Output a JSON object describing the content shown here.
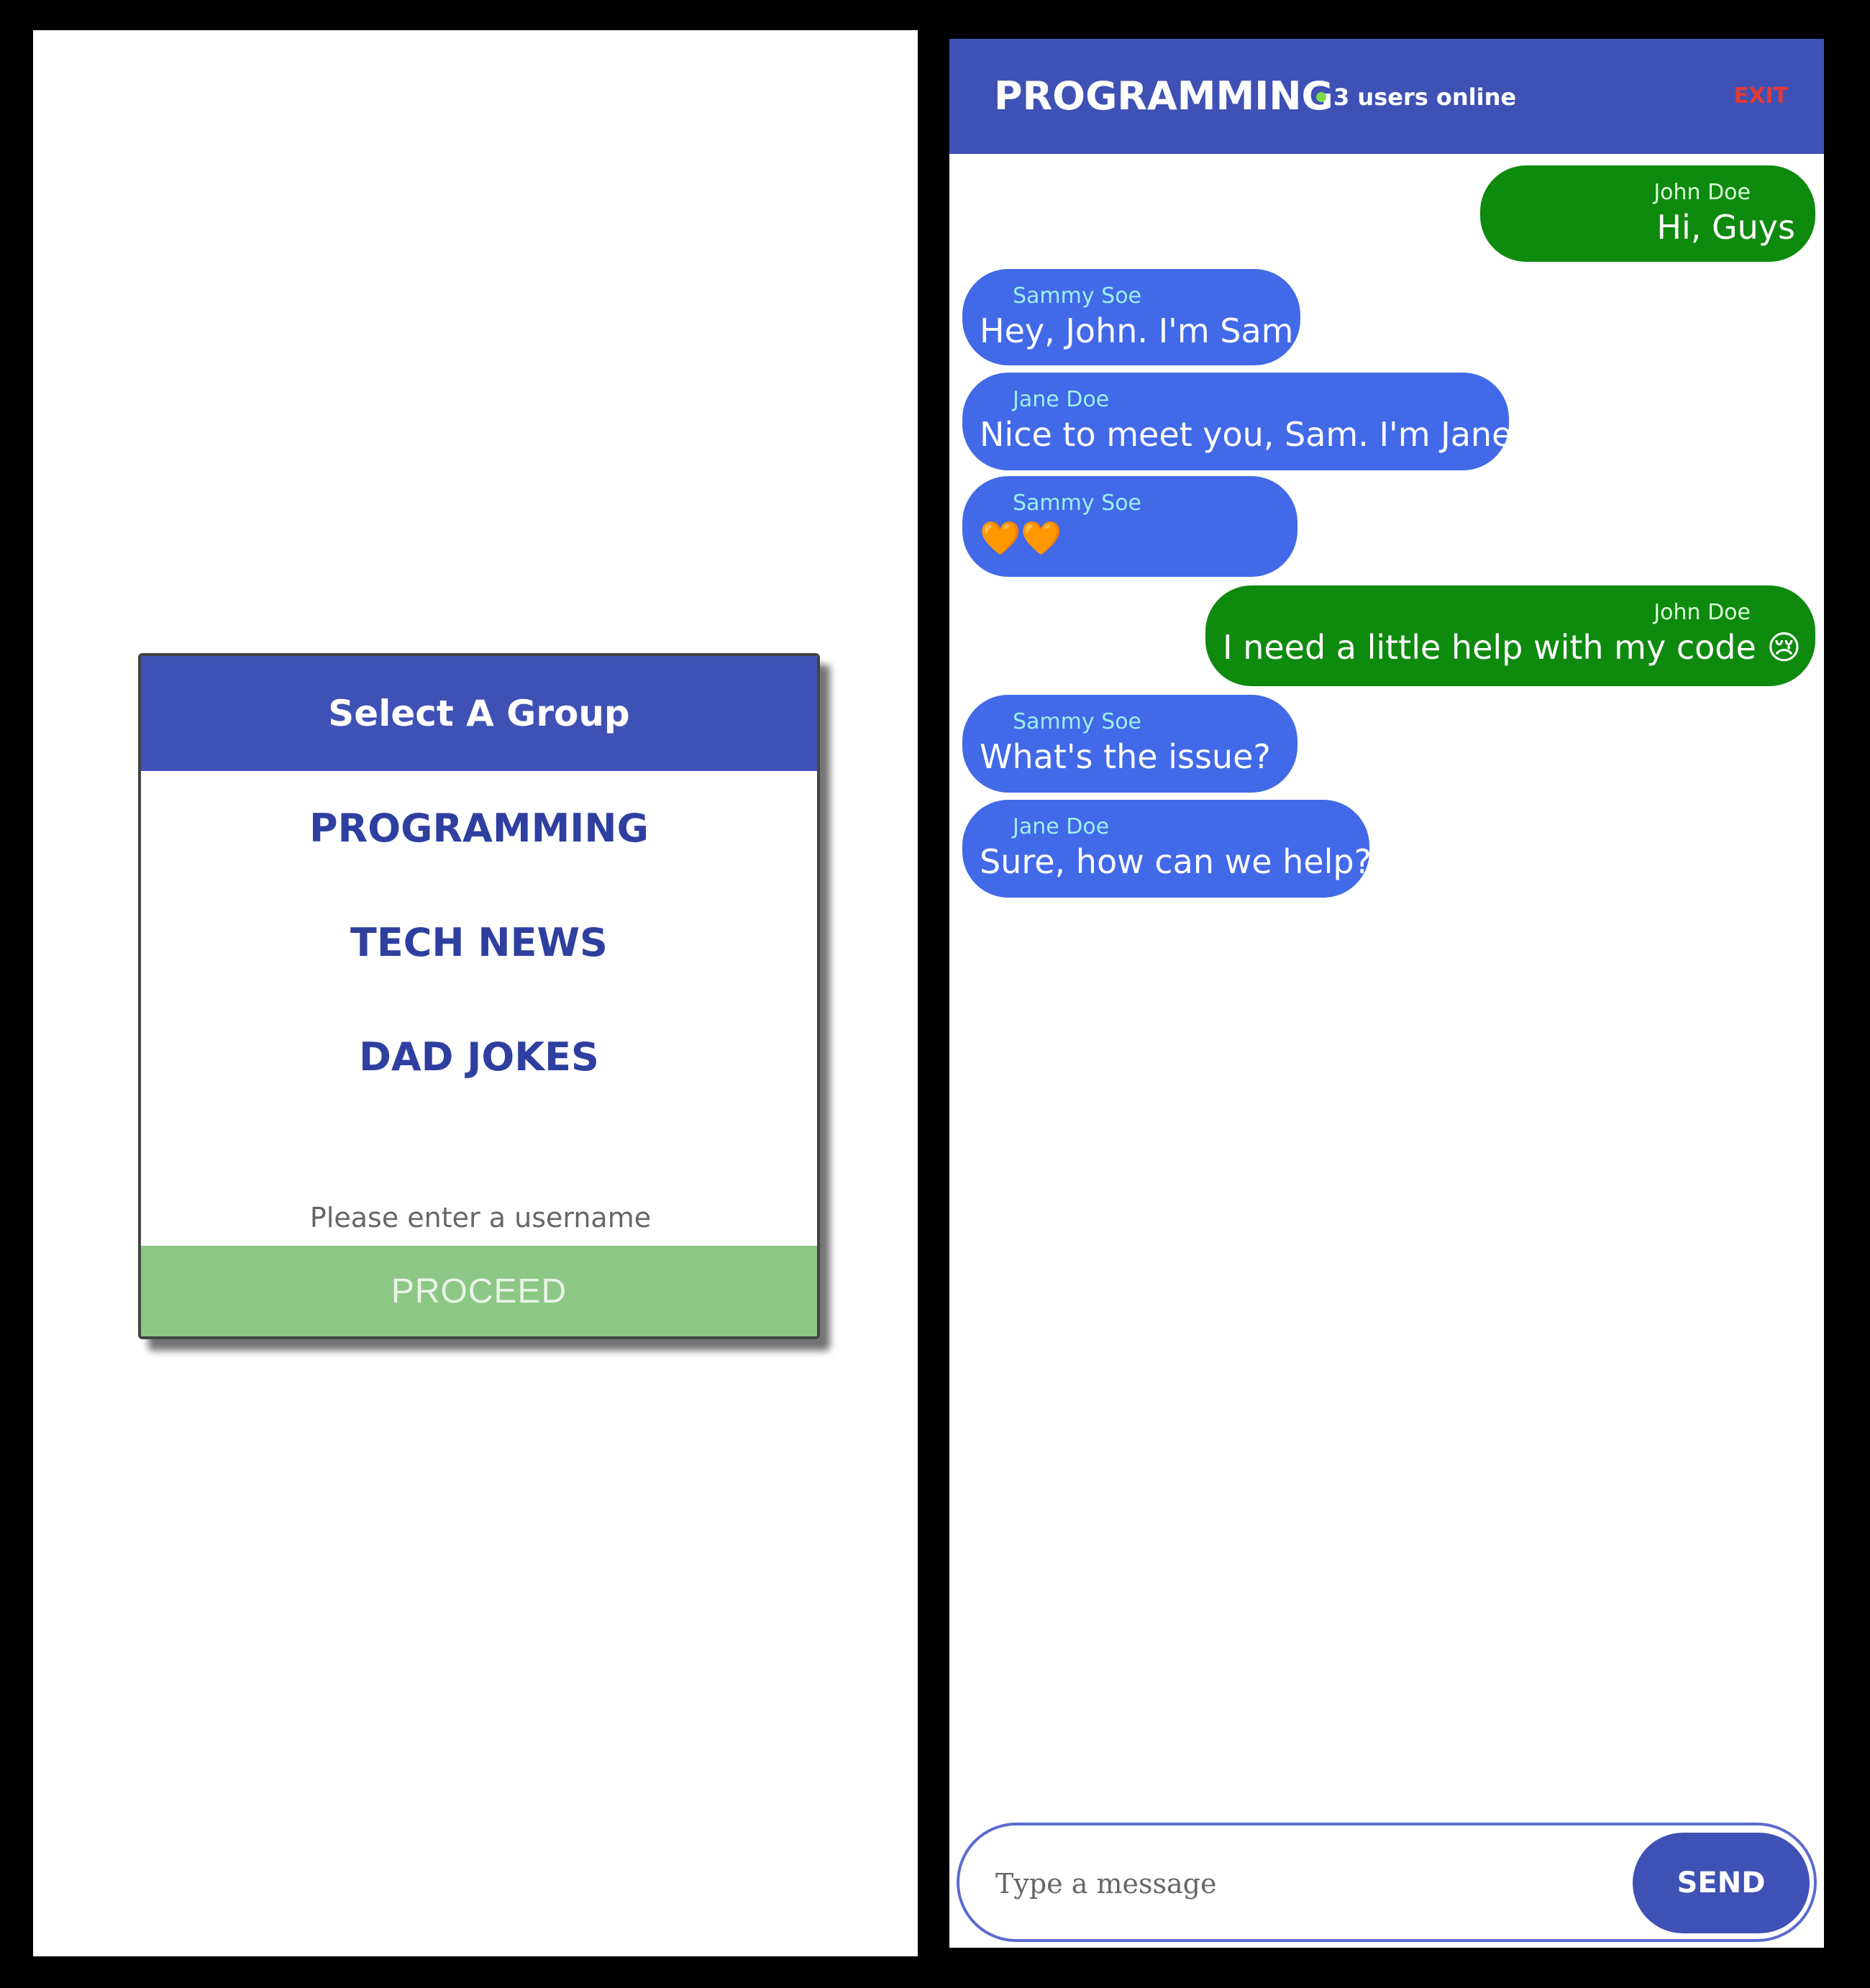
{
  "group_select": {
    "title": "Select A Group",
    "groups": [
      "PROGRAMMING",
      "TECH NEWS",
      "DAD JOKES"
    ],
    "username_placeholder": "Please enter a username",
    "proceed_label": "PROCEED"
  },
  "chat": {
    "group_name": "PROGRAMMING",
    "online_status": "3 users online",
    "exit_label": "EXIT",
    "messages": [
      {
        "sender": "John Doe",
        "text": "Hi, Guys",
        "direction": "outgoing"
      },
      {
        "sender": "Sammy Soe",
        "text": "Hey, John. I'm Sam",
        "direction": "incoming"
      },
      {
        "sender": "Jane Doe",
        "text": "Nice to meet you, Sam. I'm Jane",
        "direction": "incoming"
      },
      {
        "sender": "Sammy Soe",
        "text": "🧡🧡",
        "direction": "incoming"
      },
      {
        "sender": "John Doe",
        "text": "I need a little help with my code 😢",
        "direction": "outgoing"
      },
      {
        "sender": "Sammy Soe",
        "text": "What's the issue?",
        "direction": "incoming"
      },
      {
        "sender": "Jane Doe",
        "text": "Sure, how can we help?",
        "direction": "incoming"
      }
    ],
    "composer": {
      "placeholder": "Type a message",
      "send_label": "SEND"
    }
  },
  "colors": {
    "header_blue": "#3f51b5",
    "incoming_bubble": "#4169e8",
    "outgoing_bubble": "#0e8a0e",
    "proceed_green": "#8dc786",
    "exit_red": "#e53935",
    "online_dot": "#7ddc4a"
  },
  "icons": {
    "online": "online-dot-icon"
  }
}
